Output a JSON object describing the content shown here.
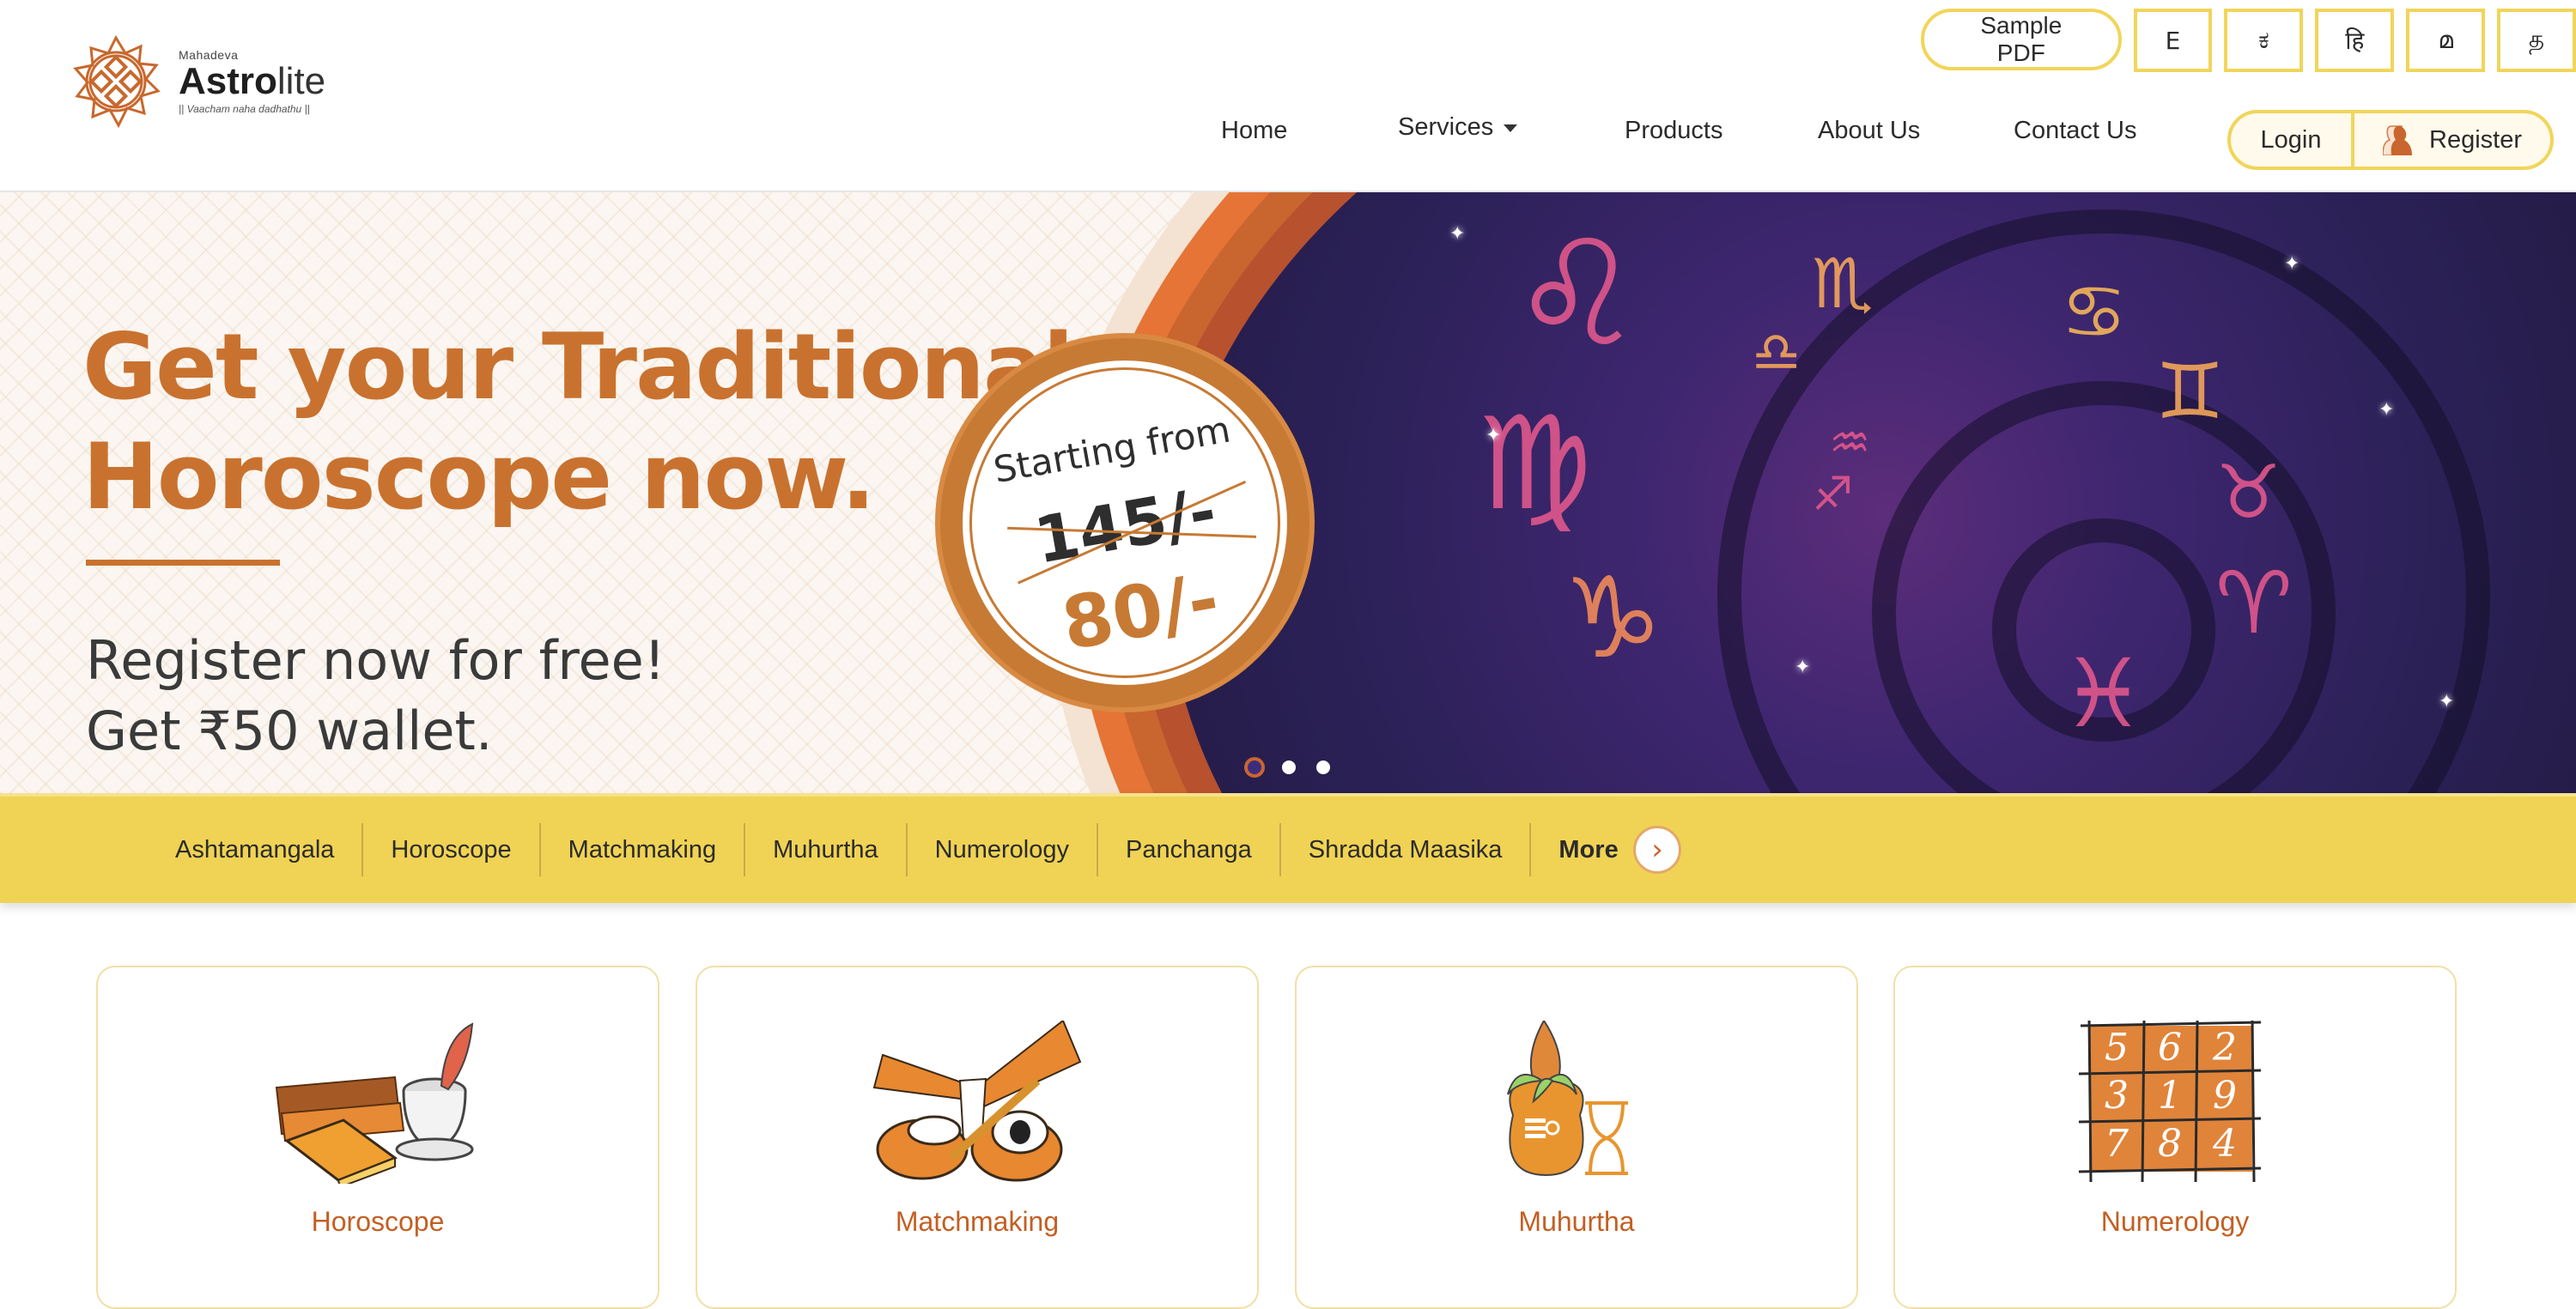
{
  "header": {
    "logo": {
      "small": "Mahadeva",
      "brand_bold": "Astro",
      "brand_light": "lite",
      "tagline": "|| Vaacham naha dadhathu ||"
    },
    "sample_pdf": "Sample PDF",
    "languages": [
      "E",
      "ಕ",
      "हि",
      "മ",
      "த"
    ],
    "nav": [
      {
        "label": "Home"
      },
      {
        "label": "Services",
        "has_dropdown": true
      },
      {
        "label": "Products"
      },
      {
        "label": "About Us"
      },
      {
        "label": "Contact Us"
      }
    ],
    "login": "Login",
    "register": "Register"
  },
  "hero": {
    "title_line1": "Get your Traditional",
    "title_line2": "Horoscope now.",
    "sub_line1": "Register now for free!",
    "sub_line2": "Get ₹50 wallet.",
    "badge": {
      "starting": "Starting from",
      "old_price": "145/-",
      "new_price": "80/-"
    },
    "zodiac_glyphs": [
      "♌",
      "♍",
      "♑",
      "♏",
      "♎",
      "♋",
      "♊",
      "♉",
      "♈",
      "♓",
      "♒",
      "♐"
    ],
    "carousel": {
      "slides": 3,
      "active": 1
    }
  },
  "services_bar": {
    "items": [
      "Ashtamangala",
      "Horoscope",
      "Matchmaking",
      "Muhurtha",
      "Numerology",
      "Panchanga",
      "Shradda Maasika"
    ],
    "more": "More",
    "next_icon": "›"
  },
  "cards": [
    {
      "label": "Horoscope",
      "icon": "palm-leaf-book-and-inkpot-icon"
    },
    {
      "label": "Matchmaking",
      "icon": "wedding-drums-icon"
    },
    {
      "label": "Muhurtha",
      "icon": "kalasha-hourglass-icon"
    },
    {
      "label": "Numerology",
      "icon": "number-grid-icon"
    }
  ],
  "numerology_grid": [
    "5",
    "6",
    "2",
    "3",
    "1",
    "9",
    "7",
    "8",
    "4"
  ],
  "colors": {
    "brand_orange": "#c9722f",
    "accent_yellow": "#f0d354",
    "card_label": "#c45f22",
    "dot_active": "#3c2d7c"
  }
}
